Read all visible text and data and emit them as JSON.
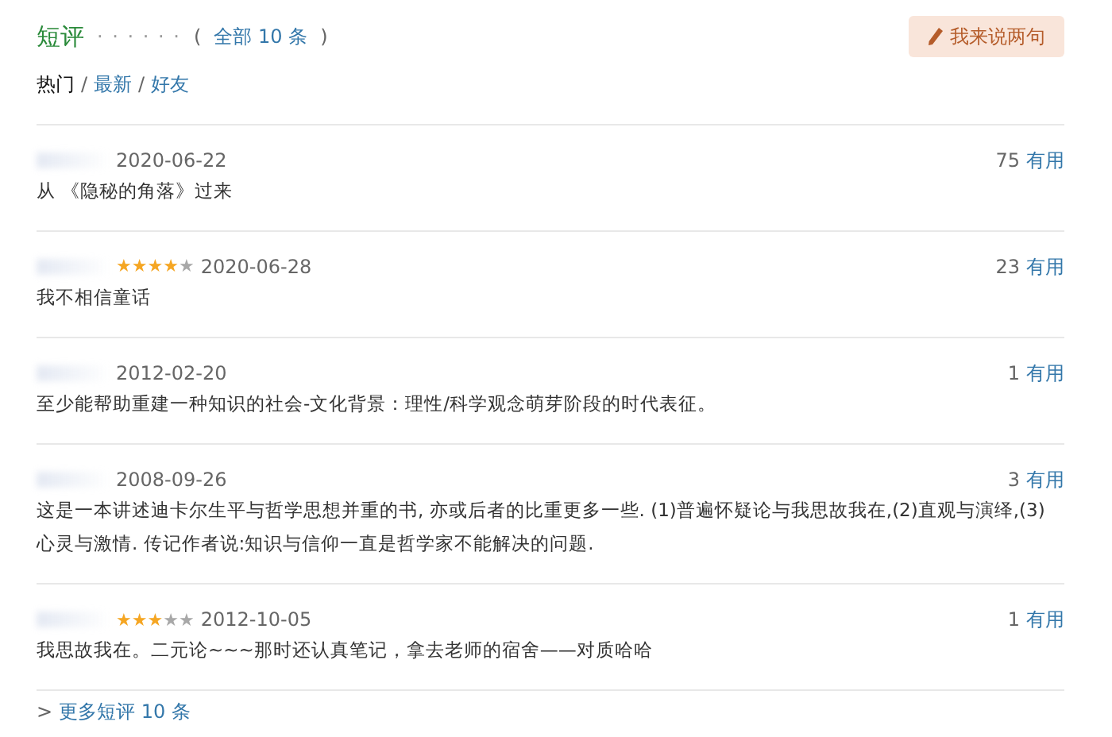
{
  "header": {
    "title": "短评",
    "dots": "· · · · · ·",
    "count_link": "全部 10 条",
    "count_open": "(",
    "count_close": ")",
    "write_button": "我来说两句"
  },
  "tabs": [
    {
      "label": "热门",
      "selected": true
    },
    {
      "label": "最新",
      "selected": false
    },
    {
      "label": "好友",
      "selected": false
    }
  ],
  "tab_separator": "/",
  "comments": [
    {
      "date": "2020-06-22",
      "votes": "75",
      "votes_label": "有用",
      "text": "从 《隐秘的角落》过来"
    },
    {
      "stars": 4,
      "date": "2020-06-28",
      "votes": "23",
      "votes_label": "有用",
      "text": "我不相信童话"
    },
    {
      "date": "2012-02-20",
      "votes": "1",
      "votes_label": "有用",
      "text": "至少能帮助重建一种知识的社会-文化背景：理性/科学观念萌芽阶段的时代表征。"
    },
    {
      "date": "2008-09-26",
      "votes": "3",
      "votes_label": "有用",
      "text": "这是一本讲述迪卡尔生平与哲学思想并重的书, 亦或后者的比重更多一些. (1)普遍怀疑论与我思故我在,(2)直观与演绎,(3)心灵与激情. 传记作者说:知识与信仰一直是哲学家不能解决的问题."
    },
    {
      "stars": 3,
      "date": "2012-10-05",
      "votes": "1",
      "votes_label": "有用",
      "text": "我思故我在。二元论~~~那时还认真笔记，拿去老师的宿舍——对质哈哈"
    }
  ],
  "more": {
    "arrow": ">",
    "link": "更多短评 10 条"
  }
}
